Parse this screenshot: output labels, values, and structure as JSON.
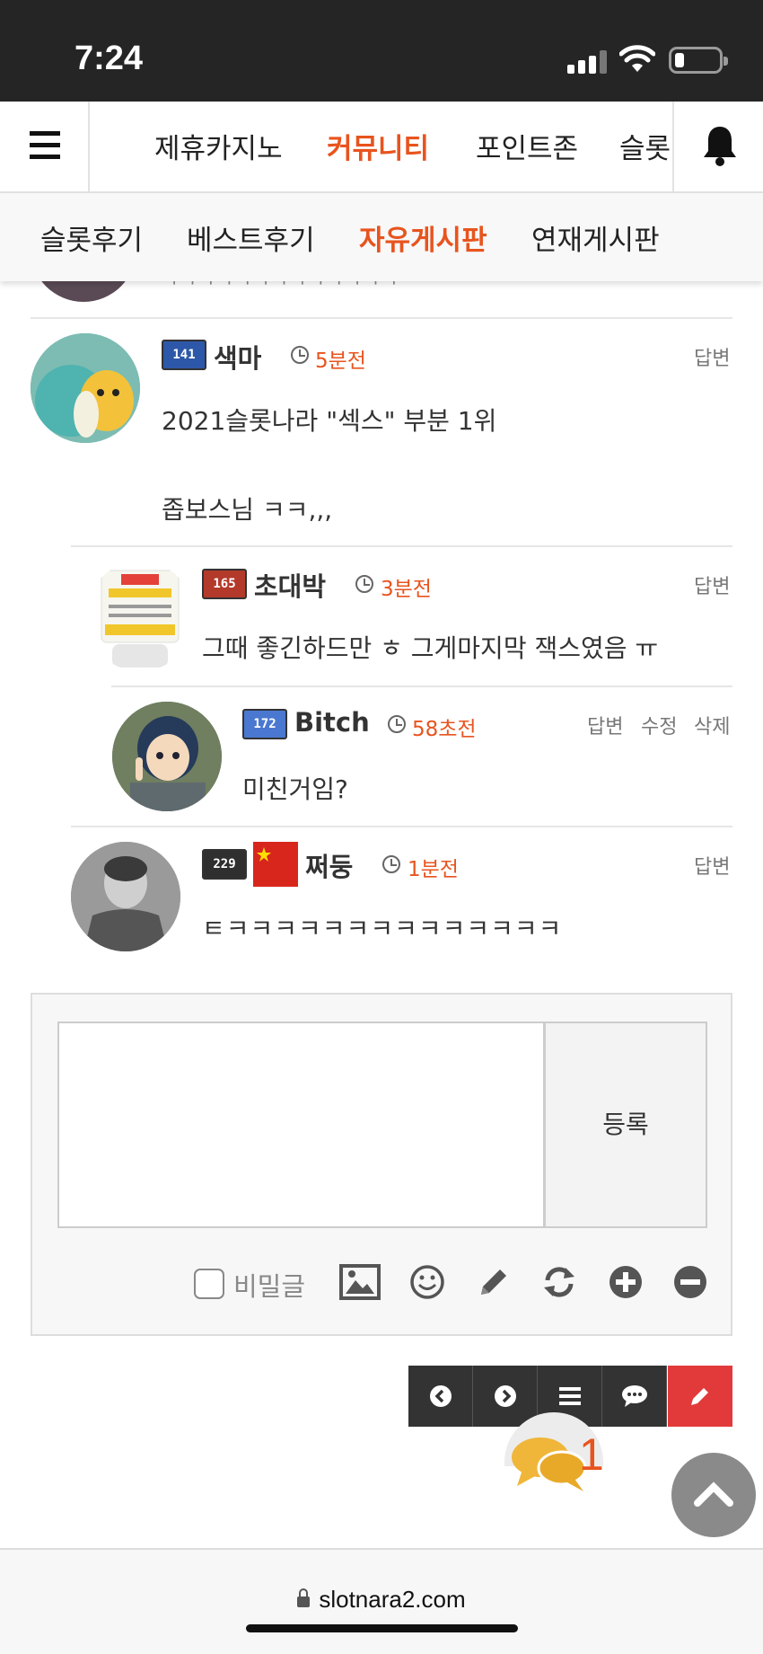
{
  "status_bar": {
    "time": "7:24"
  },
  "top_nav": {
    "tabs": [
      "제휴카지노",
      "커뮤니티",
      "포인트존",
      "슬롯"
    ],
    "active_tab": "커뮤니티"
  },
  "sub_nav": {
    "items": [
      "슬롯후기",
      "베스트후기",
      "자유게시판",
      "연재게시판"
    ],
    "active_item": "자유게시판"
  },
  "partial_comment": {
    "text": "ㅋㅋㅋㅋㅋㅋㅋㅋㅋㅋㅋㅋㅋ"
  },
  "comments": [
    {
      "nick": "색마",
      "level": "141",
      "time": "5분전",
      "actions": [
        "답변"
      ],
      "lines": [
        "2021슬롯나라 \"섹스\" 부분 1위",
        "좁보스님 ㅋㅋ,,,"
      ]
    },
    {
      "nick": "초대박",
      "level": "165",
      "time": "3분전",
      "actions": [
        "답변"
      ],
      "lines": [
        "그때 좋긴하드만 ㅎ 그게마지막 잭스였음 ㅠ"
      ]
    },
    {
      "nick": "Bitch",
      "level": "172",
      "time": "58초전",
      "actions": [
        "답변",
        "수정",
        "삭제"
      ],
      "lines": [
        "미친거임?"
      ]
    },
    {
      "nick": "쩌둥",
      "level": "229",
      "time": "1분전",
      "actions": [
        "답변"
      ],
      "lines": [
        "ㅌㅋㅋㅋㅋㅋㅋㅋㅋㅋㅋㅋㅋㅋㅋ"
      ]
    }
  ],
  "compose": {
    "submit_label": "등록",
    "secret_label": "비밀글"
  },
  "comment_count": "1",
  "browser": {
    "url": "slotnara2.com"
  },
  "colors": {
    "accent": "#e8541e",
    "write_button": "#e23a3a",
    "bubble": "#f0b63a"
  }
}
